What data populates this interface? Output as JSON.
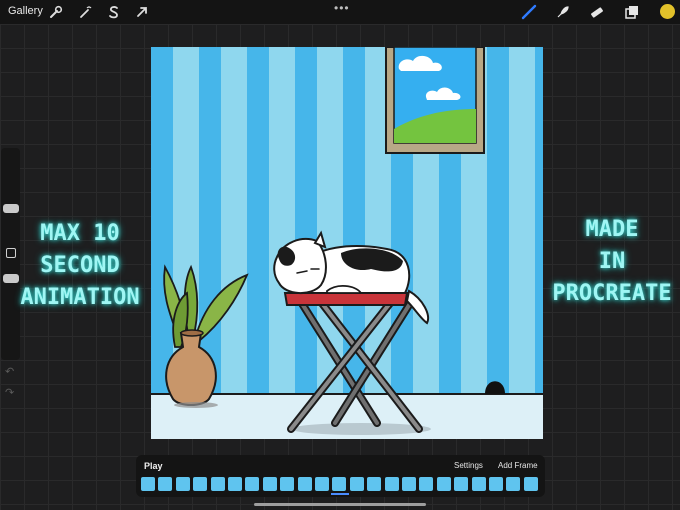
{
  "topbar": {
    "gallery_label": "Gallery",
    "more_label": "•••",
    "active_color": "#e2c12a",
    "active_tool": "brush"
  },
  "sidebar": {
    "undo_label": "↶",
    "redo_label": "↷"
  },
  "overlay": {
    "left_lines": [
      "MAX 10",
      "SECOND",
      "ANIMATION"
    ],
    "right_lines": [
      "MADE",
      "IN",
      "PROCREATE"
    ]
  },
  "timeline": {
    "play_label": "Play",
    "settings_label": "Settings",
    "add_frame_label": "Add Frame",
    "frame_count": 23,
    "current_frame": 11
  },
  "colors": {
    "frame": "#5fc4ef",
    "neon": "#9ff6f4",
    "accent": "#4a8cff"
  }
}
